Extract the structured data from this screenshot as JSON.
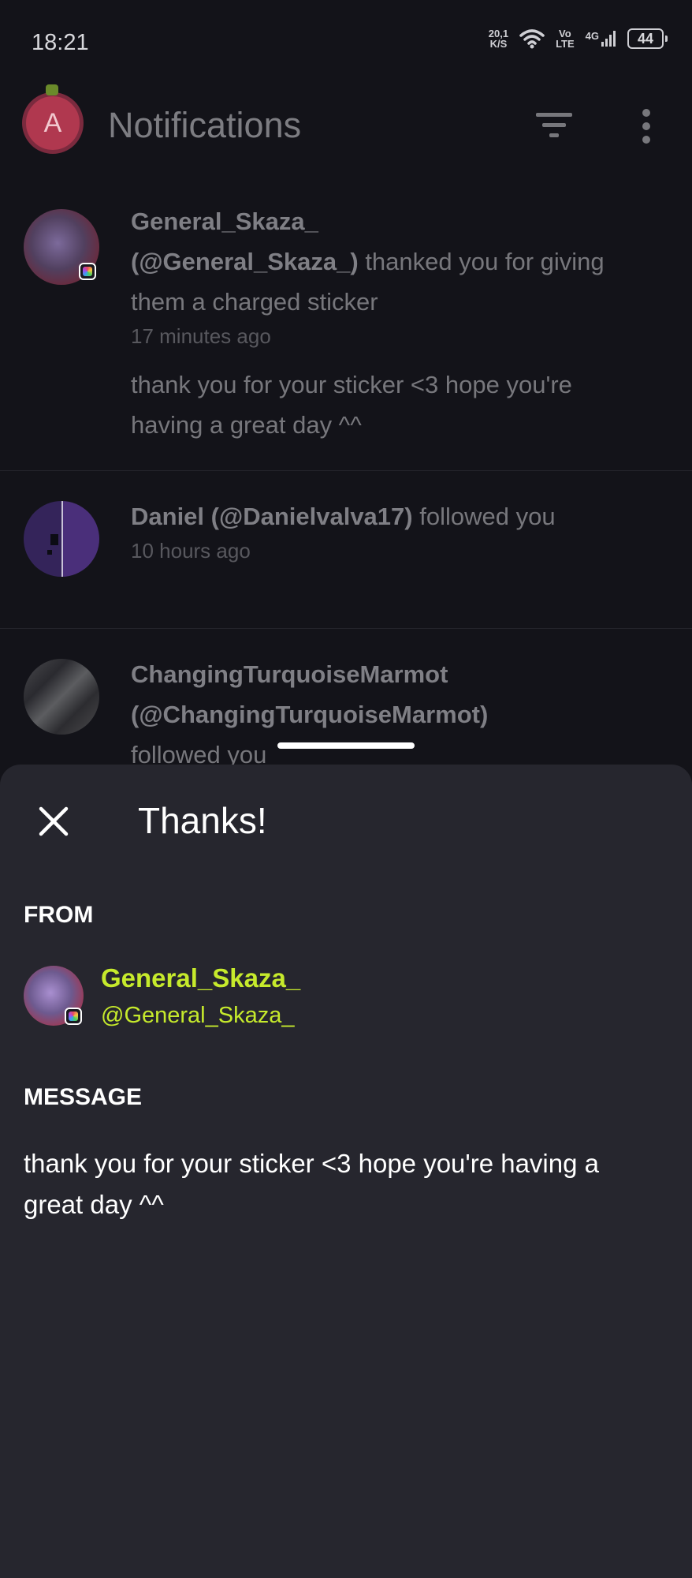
{
  "status_bar": {
    "time": "18:21",
    "net_speed_value": "20,1",
    "net_speed_unit": "K/S",
    "volte_top": "Vo",
    "volte_bottom": "LTE",
    "network": "4G",
    "battery": "44"
  },
  "app_bar": {
    "avatar_letter": "A",
    "title": "Notifications",
    "filter_icon": "filter-icon",
    "more_icon": "more-vert-icon"
  },
  "notifications": [
    {
      "name": "General_Skaza_",
      "handle": "(@General_Skaza_)",
      "action": " thanked you for giving them a charged sticker",
      "time": "17 minutes ago",
      "message": "thank you for your sticker <3  hope you're having a great day ^^"
    },
    {
      "name": "Daniel (@Danielvalva17)",
      "action": " followed you",
      "time": "10 hours ago"
    },
    {
      "name": "ChangingTurquoiseMarmot",
      "handle": "(@ChangingTurquoiseMarmot)",
      "action": "followed you"
    }
  ],
  "sheet": {
    "close_icon": "close-icon",
    "title": "Thanks!",
    "from_label": "FROM",
    "from_name": "General_Skaza_",
    "from_handle": "@General_Skaza_",
    "message_label": "MESSAGE",
    "message": "thank you for your sticker <3  hope you're having a great day ^^"
  },
  "colors": {
    "accent": "#c6ea2c",
    "background": "#131319",
    "sheet": "#26262e"
  }
}
